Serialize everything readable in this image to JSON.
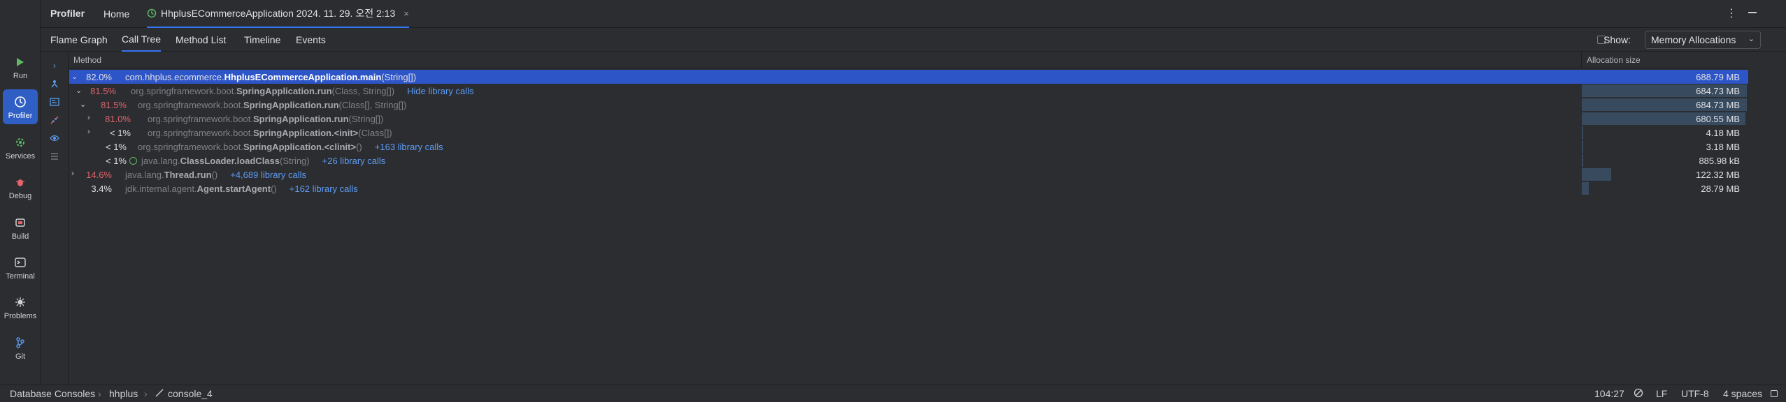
{
  "left_toolbar": [
    {
      "label": "Run",
      "icon": "run-icon",
      "color": "#5fb865",
      "active": false
    },
    {
      "label": "Profiler",
      "icon": "profiler-icon",
      "color": "#5fb865",
      "active": true
    },
    {
      "label": "Services",
      "icon": "services-icon",
      "color": "#5fb865",
      "active": false
    },
    {
      "label": "Debug",
      "icon": "debug-icon",
      "color": "#e0636d",
      "active": false
    },
    {
      "label": "Build",
      "icon": "build-icon",
      "color": "#cfd1d5",
      "active": false
    },
    {
      "label": "Terminal",
      "icon": "terminal-icon",
      "color": "#cfd1d5",
      "active": false
    },
    {
      "label": "Problems",
      "icon": "problems-icon",
      "color": "#cfd1d5",
      "active": false
    },
    {
      "label": "Git",
      "icon": "git-icon",
      "color": "#5e9cf5",
      "active": false
    }
  ],
  "title_bar": {
    "panel_title": "Profiler",
    "tabs": [
      {
        "label": "Home",
        "active": false
      },
      {
        "label": "HhplusECommerceApplication 2024. 11. 29. 오전 2:13",
        "active": true,
        "close": "×"
      }
    ],
    "more": "⋮"
  },
  "view_tabs": {
    "tabs": [
      "Flame Graph",
      "Call Tree",
      "Method List",
      "Timeline",
      "Events"
    ],
    "active": "Call Tree",
    "show_label": "Show:",
    "show_value": "Memory Allocations"
  },
  "table": {
    "col_method": "Method",
    "col_alloc": "Allocation size",
    "rows": [
      {
        "arrow": "⌄",
        "pct": "82.0%",
        "pct_color": "white",
        "prefix": "com.hhplus.ecommerce.",
        "bold": "HhplusECommerceApplication.main",
        "suffix": "(String[])",
        "lib": "",
        "size": "688.79 MB",
        "frac": 1.0,
        "selected": true,
        "depth": 0,
        "badge": false
      },
      {
        "arrow": "⌄",
        "pct": "81.5%",
        "pct_color": "red",
        "prefix": "org.springframework.boot.",
        "bold": "SpringApplication.run",
        "suffix": "(Class, String[])",
        "lib": "Hide library calls",
        "size": "684.73 MB",
        "frac": 0.994,
        "selected": false,
        "depth": 1,
        "badge": false
      },
      {
        "arrow": "⌄",
        "pct": "81.5%",
        "pct_color": "red",
        "prefix": "org.springframework.boot.",
        "bold": "SpringApplication.run",
        "suffix": "(Class[], String[])",
        "lib": "",
        "size": "684.73 MB",
        "frac": 0.994,
        "selected": false,
        "depth": 2,
        "badge": false
      },
      {
        "arrow": "›",
        "pct": "81.0%",
        "pct_color": "red",
        "prefix": "org.springframework.boot.",
        "bold": "SpringApplication.run",
        "suffix": "(String[])",
        "lib": "",
        "size": "680.55 MB",
        "frac": 0.988,
        "selected": false,
        "depth": 3,
        "badge": false
      },
      {
        "arrow": "›",
        "pct": "< 1%",
        "pct_color": "white",
        "prefix": "org.springframework.boot.",
        "bold": "SpringApplication.<init>",
        "suffix": "(Class[])",
        "lib": "",
        "size": "4.18 MB",
        "frac": 0.006,
        "selected": false,
        "depth": 3,
        "badge": false
      },
      {
        "arrow": "",
        "pct": "< 1%",
        "pct_color": "white",
        "prefix": "org.springframework.boot.",
        "bold": "SpringApplication.<clinit>",
        "suffix": "()",
        "lib": "+163 library calls",
        "size": "3.18 MB",
        "frac": 0.005,
        "selected": false,
        "depth": 2,
        "badge": false
      },
      {
        "arrow": "",
        "pct": "< 1%",
        "pct_color": "white",
        "prefix": "java.lang.",
        "bold": "ClassLoader.loadClass",
        "suffix": "(String)",
        "lib": "+26 library calls",
        "size": "885.98 kB",
        "frac": 0.0013,
        "selected": false,
        "depth": 2,
        "badge": true
      },
      {
        "arrow": "›",
        "pct": "14.6%",
        "pct_color": "red",
        "prefix": "java.lang.",
        "bold": "Thread.run",
        "suffix": "()",
        "lib": "+4,689 library calls",
        "size": "122.32 MB",
        "frac": 0.178,
        "selected": false,
        "depth": 0,
        "badge": false
      },
      {
        "arrow": "",
        "pct": "3.4%",
        "pct_color": "white",
        "prefix": "jdk.internal.agent.",
        "bold": "Agent.startAgent",
        "suffix": "()",
        "lib": "+162 library calls",
        "size": "28.79 MB",
        "frac": 0.042,
        "selected": false,
        "depth": 0,
        "badge": false
      }
    ]
  },
  "status_bar": {
    "breadcrumbs": [
      "Database Consoles",
      "hhplus",
      "console_4"
    ],
    "position": "104:27",
    "line_ending": "LF",
    "encoding": "UTF-8",
    "indent": "4 spaces"
  }
}
